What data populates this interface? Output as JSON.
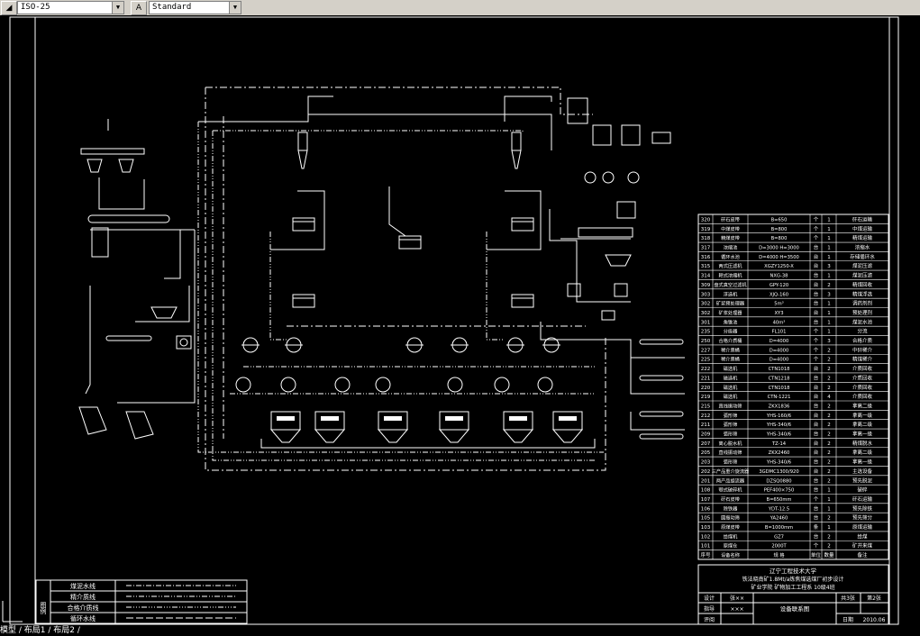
{
  "toolbar": {
    "dimstyle_value": "ISO-25",
    "textstyle_value": "Standard"
  },
  "status": {
    "tabs_text": "模型 / 布局1 / 布局2 /"
  },
  "legend": {
    "side_label": "图例",
    "lines": [
      "煤泥水线",
      "精介质线",
      "合格介质线",
      "循环水线"
    ]
  },
  "equipment_rows": [
    [
      "320",
      "矸石皮带",
      "B=650",
      "个",
      "1",
      "矸石运输"
    ],
    [
      "319",
      "中煤皮带",
      "B=800",
      "个",
      "1",
      "中煤运输"
    ],
    [
      "318",
      "精煤皮带",
      "B=800",
      "个",
      "1",
      "精煤运输"
    ],
    [
      "317",
      "浓缩池",
      "D=3000 H=3000",
      "台",
      "1",
      "浓缩水"
    ],
    [
      "316",
      "循环水池",
      "D=4000 H=3500",
      "台",
      "1",
      "存储循环水"
    ],
    [
      "315",
      "两式压滤机",
      "XGZY1250-X",
      "台",
      "3",
      "煤泥压滤"
    ],
    [
      "314",
      "耙式浓缩机",
      "NXG-38",
      "台",
      "1",
      "煤泥压滤"
    ],
    [
      "309",
      "盘式真空过滤机",
      "GPY-120",
      "台",
      "2",
      "精煤回收"
    ],
    [
      "303",
      "浮选机",
      "XJQ-160",
      "台",
      "3",
      "精煤浮选"
    ],
    [
      "302",
      "矿浆预处理器",
      "5m³",
      "台",
      "1",
      "调药剂剂"
    ],
    [
      "302",
      "矿浆处理器",
      "XY3",
      "台",
      "1",
      "预处理剂"
    ],
    [
      "301",
      "角锥池",
      "40m³",
      "台",
      "1",
      "煤泥水池"
    ],
    [
      "235",
      "分级器",
      "FL101",
      "个",
      "1",
      "分流"
    ],
    [
      "250",
      "合格介质桶",
      "D=4000",
      "个",
      "3",
      "合格介质"
    ],
    [
      "227",
      "稀介质桶",
      "D=4000",
      "个",
      "2",
      "中矸稀介"
    ],
    [
      "225",
      "稀介质桶",
      "D=4000",
      "个",
      "2",
      "精煤稀介"
    ],
    [
      "222",
      "磁选机",
      "CTN1018",
      "台",
      "2",
      "介质回收"
    ],
    [
      "221",
      "磁选机",
      "CTN1218",
      "台",
      "2",
      "介质回收"
    ],
    [
      "220",
      "磁选机",
      "CTN1018",
      "台",
      "2",
      "介质回收"
    ],
    [
      "219",
      "磁选机",
      "CTN-1221",
      "台",
      "4",
      "介质回收"
    ],
    [
      "215",
      "直线振动筛",
      "ZKX1836",
      "台",
      "2",
      "拿离二级"
    ],
    [
      "212",
      "弧形筛",
      "YHS-160/6",
      "台",
      "2",
      "拿离一级"
    ],
    [
      "211",
      "弧形筛",
      "YHS-340/6",
      "台",
      "2",
      "拿离二级"
    ],
    [
      "209",
      "弧形筛",
      "YHS-340/6",
      "台",
      "2",
      "拿离一级"
    ],
    [
      "207",
      "离心脱水机",
      "TZ-14",
      "台",
      "2",
      "精煤脱水"
    ],
    [
      "205",
      "直线振动筛",
      "ZKX2460",
      "台",
      "2",
      "拿离二级"
    ],
    [
      "203",
      "弧形筛",
      "YHS-340/6",
      "台",
      "2",
      "拿离一级"
    ],
    [
      "202",
      "三产品重介旋流器",
      "3GDMC1300/920",
      "台",
      "2",
      "主选设备"
    ],
    [
      "201",
      "两产品旋流器",
      "DZSQ0880",
      "台",
      "2",
      "预先脱泥"
    ],
    [
      "108",
      "颚式破碎机",
      "PEF400×750",
      "台",
      "1",
      "破碎"
    ],
    [
      "107",
      "矸石皮带",
      "B=650mm",
      "个",
      "1",
      "矸石运输"
    ],
    [
      "106",
      "除铁器",
      "YDT-12.5",
      "台",
      "1",
      "预先除铁"
    ],
    [
      "105",
      "圆振动筛",
      "YA2460",
      "台",
      "2",
      "预先筛分"
    ],
    [
      "103",
      "原煤皮带",
      "B=1000mm",
      "条",
      "1",
      "原煤运输"
    ],
    [
      "102",
      "给煤机",
      "GZ7",
      "台",
      "2",
      "给煤"
    ],
    [
      "101",
      "原煤仓",
      "2000T",
      "个",
      "2",
      "矿井来煤"
    ]
  ],
  "table_header": [
    "序号",
    "设备名称",
    "规 格",
    "单位",
    "数量",
    "备注"
  ],
  "title_block": {
    "line1": "辽宁工程技术大学",
    "line2": "铁法晓南矿1.8Mt/a炼焦煤选煤厂初步设计",
    "line3": "矿业学院  矿物加工工程系  10级4班",
    "role_design": "设计",
    "name_design": "张××",
    "role_guide": "指导",
    "name_guide": "×××",
    "role_review": "评阅",
    "drawing_title": "设备联系图",
    "sheets_total": "共3张",
    "sheet_no": "第2张",
    "date_label": "日期",
    "date_value": "2010.06"
  },
  "colors": {
    "ui_gray": "#d4d0c8",
    "drawing_bg": "#000000",
    "lines": "#ffffff"
  }
}
